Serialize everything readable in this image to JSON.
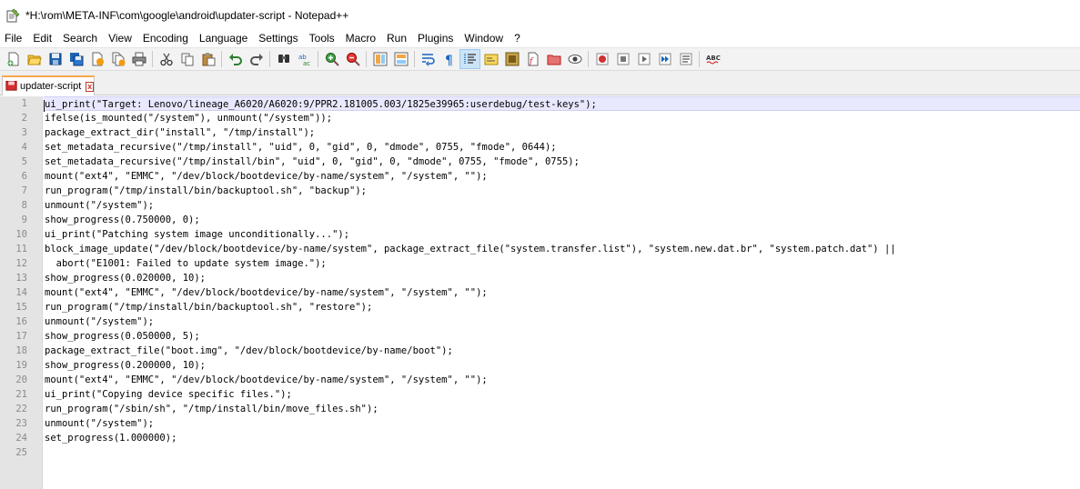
{
  "window": {
    "title": "*H:\\rom\\META-INF\\com\\google\\android\\updater-script - Notepad++"
  },
  "menu": {
    "items": [
      "File",
      "Edit",
      "Search",
      "View",
      "Encoding",
      "Language",
      "Settings",
      "Tools",
      "Macro",
      "Run",
      "Plugins",
      "Window",
      "?"
    ]
  },
  "toolbar": {
    "buttons": [
      "new-file-icon",
      "open-file-icon",
      "save-icon",
      "save-all-icon",
      "close-icon",
      "close-all-icon",
      "print-icon",
      "cut-icon",
      "copy-icon",
      "paste-icon",
      "undo-icon",
      "redo-icon",
      "find-icon",
      "replace-icon",
      "zoom-in-icon",
      "zoom-out-icon",
      "sync-vertical-icon",
      "sync-horizontal-icon",
      "word-wrap-icon",
      "show-all-chars-icon",
      "indent-guide-icon",
      "user-language-icon",
      "doc-map-icon",
      "function-list-icon",
      "folder-workspace-icon",
      "monitoring-icon",
      "record-macro-icon",
      "stop-macro-icon",
      "play-macro-icon",
      "run-macro-multiple-icon",
      "save-macro-icon",
      "spell-check-icon"
    ],
    "spell_check_label": "ABC"
  },
  "tabs": [
    {
      "label": "updater-script",
      "close": "x"
    }
  ],
  "editor": {
    "lines": [
      "ui_print(\"Target: Lenovo/lineage_A6020/A6020:9/PPR2.181005.003/1825e39965:userdebug/test-keys\");",
      "ifelse(is_mounted(\"/system\"), unmount(\"/system\"));",
      "package_extract_dir(\"install\", \"/tmp/install\");",
      "set_metadata_recursive(\"/tmp/install\", \"uid\", 0, \"gid\", 0, \"dmode\", 0755, \"fmode\", 0644);",
      "set_metadata_recursive(\"/tmp/install/bin\", \"uid\", 0, \"gid\", 0, \"dmode\", 0755, \"fmode\", 0755);",
      "mount(\"ext4\", \"EMMC\", \"/dev/block/bootdevice/by-name/system\", \"/system\", \"\");",
      "run_program(\"/tmp/install/bin/backuptool.sh\", \"backup\");",
      "unmount(\"/system\");",
      "show_progress(0.750000, 0);",
      "ui_print(\"Patching system image unconditionally...\");",
      "block_image_update(\"/dev/block/bootdevice/by-name/system\", package_extract_file(\"system.transfer.list\"), \"system.new.dat.br\", \"system.patch.dat\") ||",
      "  abort(\"E1001: Failed to update system image.\");",
      "show_progress(0.020000, 10);",
      "mount(\"ext4\", \"EMMC\", \"/dev/block/bootdevice/by-name/system\", \"/system\", \"\");",
      "run_program(\"/tmp/install/bin/backuptool.sh\", \"restore\");",
      "unmount(\"/system\");",
      "show_progress(0.050000, 5);",
      "package_extract_file(\"boot.img\", \"/dev/block/bootdevice/by-name/boot\");",
      "show_progress(0.200000, 10);",
      "mount(\"ext4\", \"EMMC\", \"/dev/block/bootdevice/by-name/system\", \"/system\", \"\");",
      "ui_print(\"Copying device specific files.\");",
      "run_program(\"/sbin/sh\", \"/tmp/install/bin/move_files.sh\");",
      "unmount(\"/system\");",
      "set_progress(1.000000);",
      ""
    ]
  },
  "colors": {
    "current_line": "#e8e8ff",
    "gutter": "#e4e4e4",
    "tab_accent": "#f9a74b"
  }
}
